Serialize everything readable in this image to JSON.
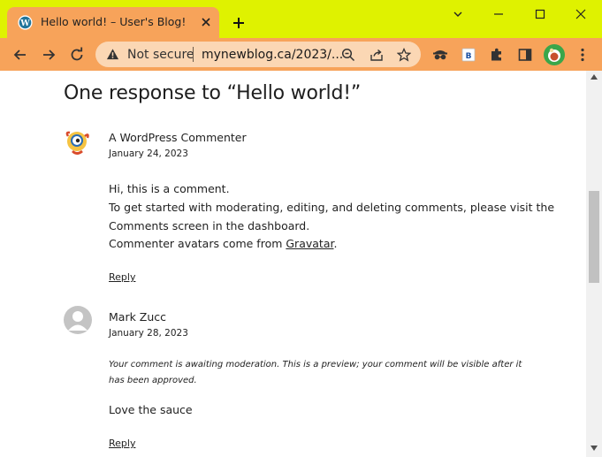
{
  "browser": {
    "tab": {
      "title": "Hello world! – User's Blog!"
    },
    "omnibox": {
      "security_label": "Not secure",
      "url": "mynewblog.ca/2023/..."
    },
    "colors": {
      "titlebar": "#dff200",
      "toolbar": "#f7a35a",
      "omnibox": "#fbd7b4"
    }
  },
  "page": {
    "heading": "One response to “Hello world!”",
    "comments": [
      {
        "author": "A WordPress Commenter",
        "date": "January 24, 2023",
        "lines": [
          "Hi, this is a comment.",
          "To get started with moderating, editing, and deleting comments, please visit the",
          "Comments screen in the dashboard."
        ],
        "avatar_line_prefix": "Commenter avatars come from ",
        "avatar_link": "Gravatar",
        "avatar_line_suffix": ".",
        "reply_label": "Reply"
      },
      {
        "author": "Mark Zucc",
        "date": "January 28, 2023",
        "moderation_lines": [
          "Your comment is awaiting moderation. This is a preview; your comment will be visible after it",
          "has been approved."
        ],
        "text": "Love the sauce",
        "reply_label": "Reply"
      }
    ]
  }
}
